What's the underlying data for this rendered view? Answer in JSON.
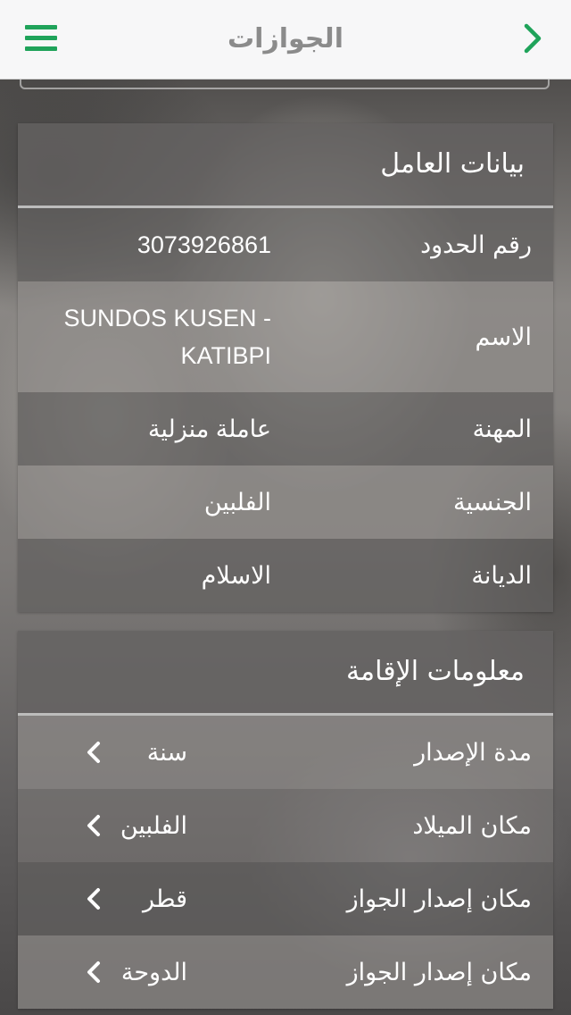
{
  "header": {
    "title": "الجوازات",
    "menu_icon": "menu-icon",
    "back_icon": "chevron-right-icon",
    "accent": "#1fa35a"
  },
  "worker": {
    "title": "بيانات العامل",
    "rows": [
      {
        "label": "رقم الحدود",
        "value": "3073926861"
      },
      {
        "label": "الاسم",
        "value": "SUNDOS KUSEN - KATIBPI"
      },
      {
        "label": "المهنة",
        "value": "عاملة منزلية"
      },
      {
        "label": "الجنسية",
        "value": "الفلبين"
      },
      {
        "label": "الديانة",
        "value": "الاسلام"
      }
    ]
  },
  "residency": {
    "title": "معلومات الإقامة",
    "rows": [
      {
        "label": "مدة الإصدار",
        "value": "سنة"
      },
      {
        "label": "مكان الميلاد",
        "value": "الفلبين"
      },
      {
        "label": "مكان إصدار الجواز",
        "value": "قطر"
      },
      {
        "label": "مكان إصدار الجواز",
        "value": "الدوحة"
      }
    ]
  }
}
